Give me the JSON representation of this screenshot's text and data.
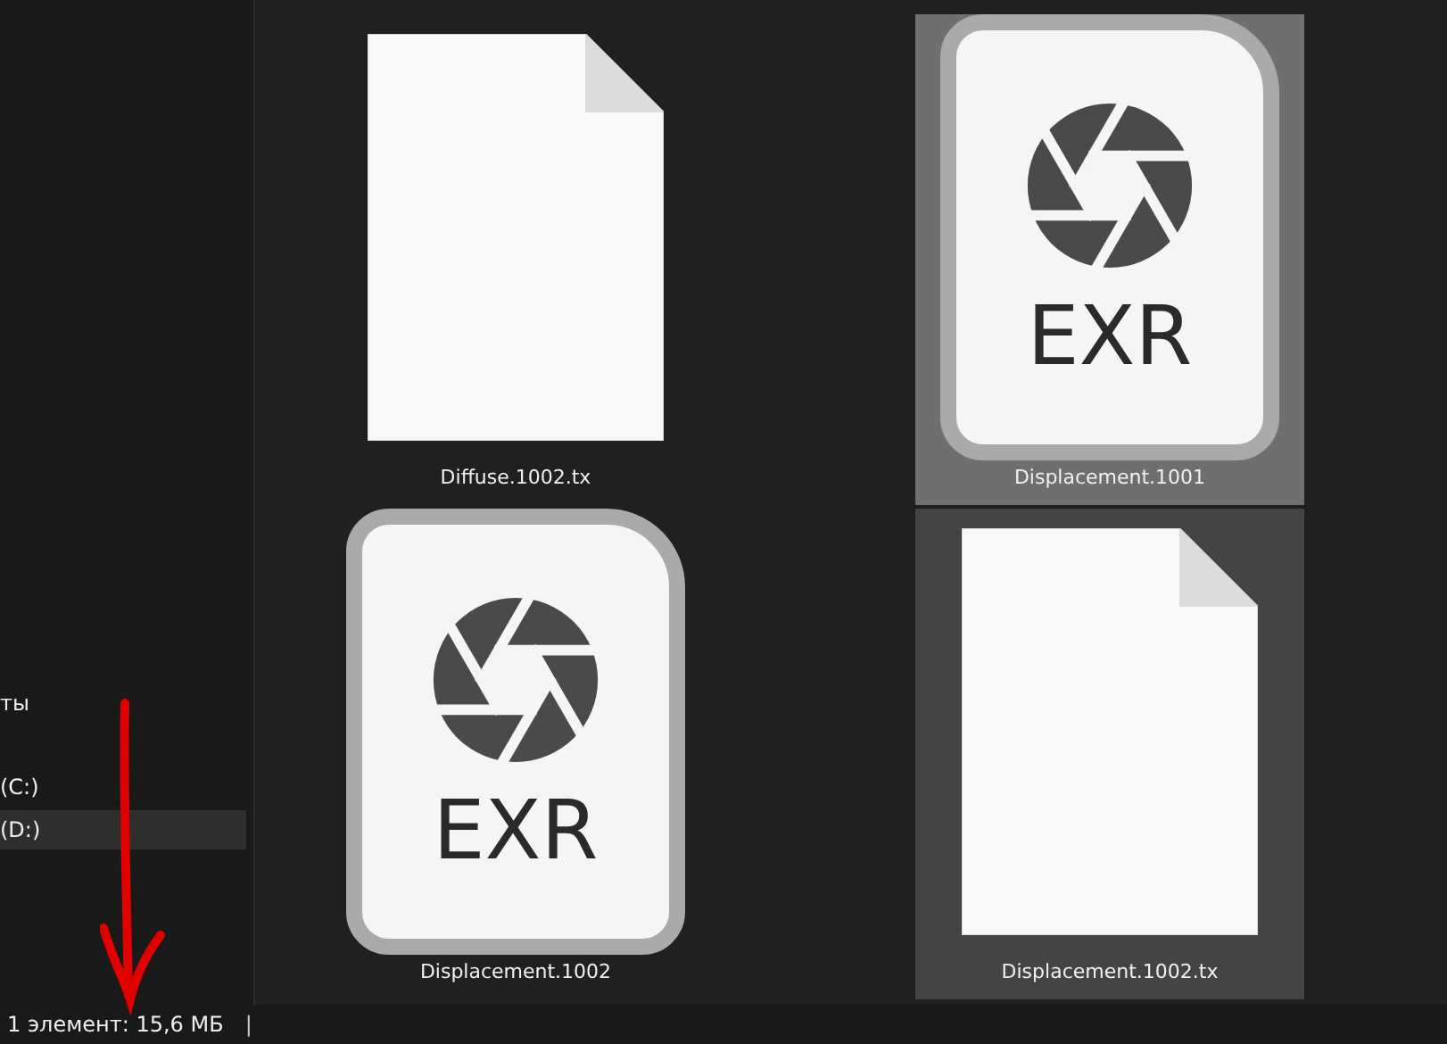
{
  "sidebar": {
    "items": [
      {
        "label": "ты",
        "selected": false
      },
      {
        "label": "(C:)",
        "selected": false
      },
      {
        "label": "(D:)",
        "selected": true
      }
    ]
  },
  "files": [
    {
      "name": "Diffuse.1002.tx",
      "kind": "blank",
      "selected": false,
      "hovered": false
    },
    {
      "name": "Displacement.1001",
      "kind": "exr",
      "icon_label": "EXR",
      "selected": true,
      "hovered": false
    },
    {
      "name": "Displacement.1002",
      "kind": "exr",
      "icon_label": "EXR",
      "selected": false,
      "hovered": false
    },
    {
      "name": "Displacement.1002.tx",
      "kind": "blank",
      "selected": false,
      "hovered": true
    }
  ],
  "status_bar": {
    "selection": "1 элемент: 15,6 МБ",
    "separator": "|"
  }
}
